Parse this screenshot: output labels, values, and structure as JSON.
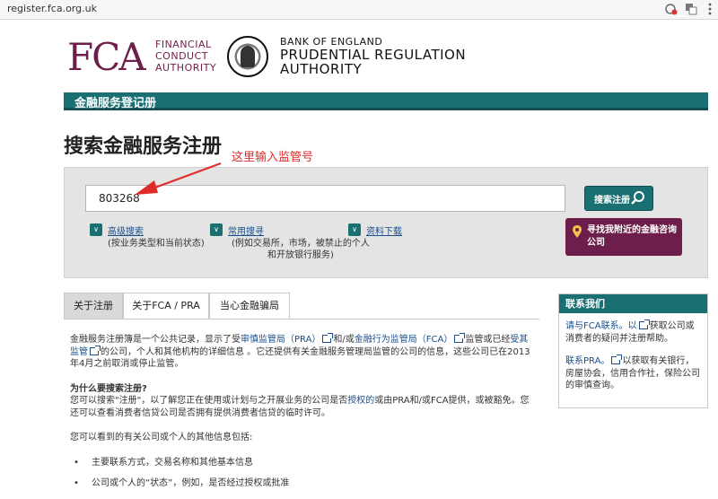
{
  "browser": {
    "url": "register.fca.org.uk"
  },
  "header": {
    "fca_mark": "FCA",
    "fca_text": [
      "FINANCIAL",
      "CONDUCT",
      "AUTHORITY"
    ],
    "boe_line1": "BANK OF ENGLAND",
    "boe_line2": "PRUDENTIAL REGULATION",
    "boe_line3": "AUTHORITY"
  },
  "banner": {
    "title": "金融服务登记册"
  },
  "page": {
    "title": "搜索金融服务注册",
    "annotation": "这里输入监管号"
  },
  "search": {
    "value": "803268",
    "button_label": "搜索注册",
    "options": [
      {
        "label": "高级搜索",
        "desc1": "(按业务类型和当前状态)",
        "desc2": ""
      },
      {
        "label": "常用搜寻",
        "desc1": "(例如交易所，市场，被禁止的个人",
        "desc2": "和开放银行服务)"
      },
      {
        "label": "资料下载",
        "desc1": "",
        "desc2": ""
      }
    ],
    "advice_label": "寻找我附近的金融咨询公司"
  },
  "tabs": [
    "关于注册",
    "关于FCA / PRA",
    "当心金融骗局"
  ],
  "content": {
    "p1_a": "金融服务注册簿是一个公共记录，显示了受",
    "link_pra": "审慎监管局（PRA）",
    "p1_b": "和/或",
    "link_fca": "金融行为监管局（FCA）",
    "p1_c": "监管或已经",
    "link_regulated": "受其监管",
    "p1_d": "的公司，个人和其他机构的详细信息 。它还提供有关金融服务管理局监管的公司的信息，这些公司已在2013年4月之前取消或停止监管。",
    "q_title": "为什么要搜索注册?",
    "q_a": "您可以搜索\"注册\"，以了解您正在使用或计划与之开展业务的公司是否",
    "link_authorised": "授权的",
    "q_b": "或由PRA和/或FCA提供，或被豁免。您还可以查看消费者信贷公司是否拥有提供消费者信贷的临时许可。",
    "info_intro": "您可以看到的有关公司或个人的其他信息包括:",
    "bullets": [
      "主要联系方式，交易名称和其他基本信息",
      "公司或个人的“状态”，例如，是否经过授权或批准"
    ]
  },
  "contact": {
    "title": "联系我们",
    "link1": "请与FCA联系。以",
    "text1": "获取公司或消费者的疑问并注册帮助。",
    "link2": "联系PRA。",
    "text2": "以获取有关银行，房屋协会，信用合作社，保险公司的审慎查询。"
  }
}
